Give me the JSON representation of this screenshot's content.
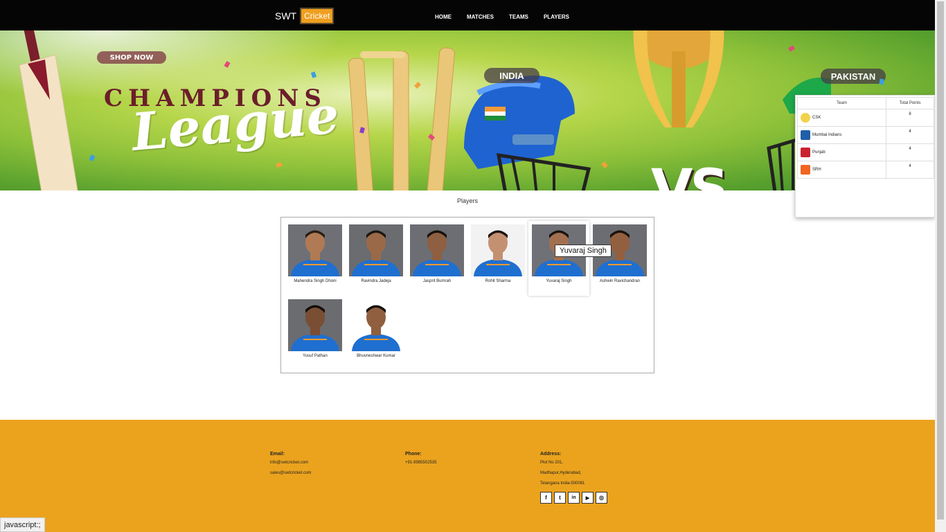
{
  "brand": {
    "part1": "SWT",
    "part2": "Cricket"
  },
  "nav": [
    "HOME",
    "MATCHES",
    "TEAMS",
    "PLAYERS"
  ],
  "hero": {
    "headline_top": "CHAMPIONS",
    "headline_main": "League",
    "team_left": "INDIA",
    "team_right": "PAKISTAN",
    "vs": "VS",
    "shop_label": "SHOP NOW"
  },
  "points_table": {
    "headers": [
      "Team",
      "Total Points"
    ],
    "rows": [
      {
        "team": "CSK",
        "points": "8",
        "logo_color": "#f2d24a"
      },
      {
        "team": "Mumbai Indians",
        "points": "4",
        "logo_color": "#1f5fa8"
      },
      {
        "team": "Punjab",
        "points": "4",
        "logo_color": "#c8242f"
      },
      {
        "team": "SRH",
        "points": "4",
        "logo_color": "#f26522"
      }
    ]
  },
  "players_section": {
    "title": "Players",
    "players": [
      {
        "name": "Mahendra Singh Dhoni",
        "skin": "#b07a55",
        "hair": "#2a1e16",
        "bg": "#6f7075"
      },
      {
        "name": "Ravindra Jadeja",
        "skin": "#9a6a48",
        "hair": "#1d1510",
        "bg": "#6a6c70"
      },
      {
        "name": "Jasprit Bumrah",
        "skin": "#8e5f40",
        "hair": "#17110c",
        "bg": "#6d6e73"
      },
      {
        "name": "Rohit Sharma",
        "skin": "#c49072",
        "hair": "#1c1410",
        "bg": "#f2f2f2"
      },
      {
        "name": "Yuvaraj Singh",
        "skin": "#a27050",
        "hair": "#1a120e",
        "bg": "#707176"
      },
      {
        "name": "Ashwin Ravichandran",
        "skin": "#93603f",
        "hair": "#1a120d",
        "bg": "#6c6d72"
      },
      {
        "name": "Yusuf Pathan",
        "skin": "#7a4e33",
        "hair": "#120c08",
        "bg": "#6b6c70"
      },
      {
        "name": "Bhuvneshwar Kumar",
        "skin": "#8f5f40",
        "hair": "#140e0a",
        "bg": "#ffffff"
      }
    ],
    "tooltip": "Yuvaraj Singh"
  },
  "footer": {
    "email": {
      "label": "Email:",
      "lines": [
        "info@swtcricket.com",
        "sales@swtcricket.com"
      ]
    },
    "phone": {
      "label": "Phone:",
      "lines": [
        "+91-9985502535"
      ]
    },
    "address": {
      "label": "Address:",
      "lines": [
        "Plot No 201,",
        "Madhapur,Hyderabad,",
        "Telangana India-500081"
      ]
    },
    "socials": [
      "f",
      "t",
      "in",
      "▶",
      "◎"
    ]
  },
  "status_bar": "javascript:;",
  "colors": {
    "accent": "#eba31e",
    "nav_bg": "#050505"
  }
}
